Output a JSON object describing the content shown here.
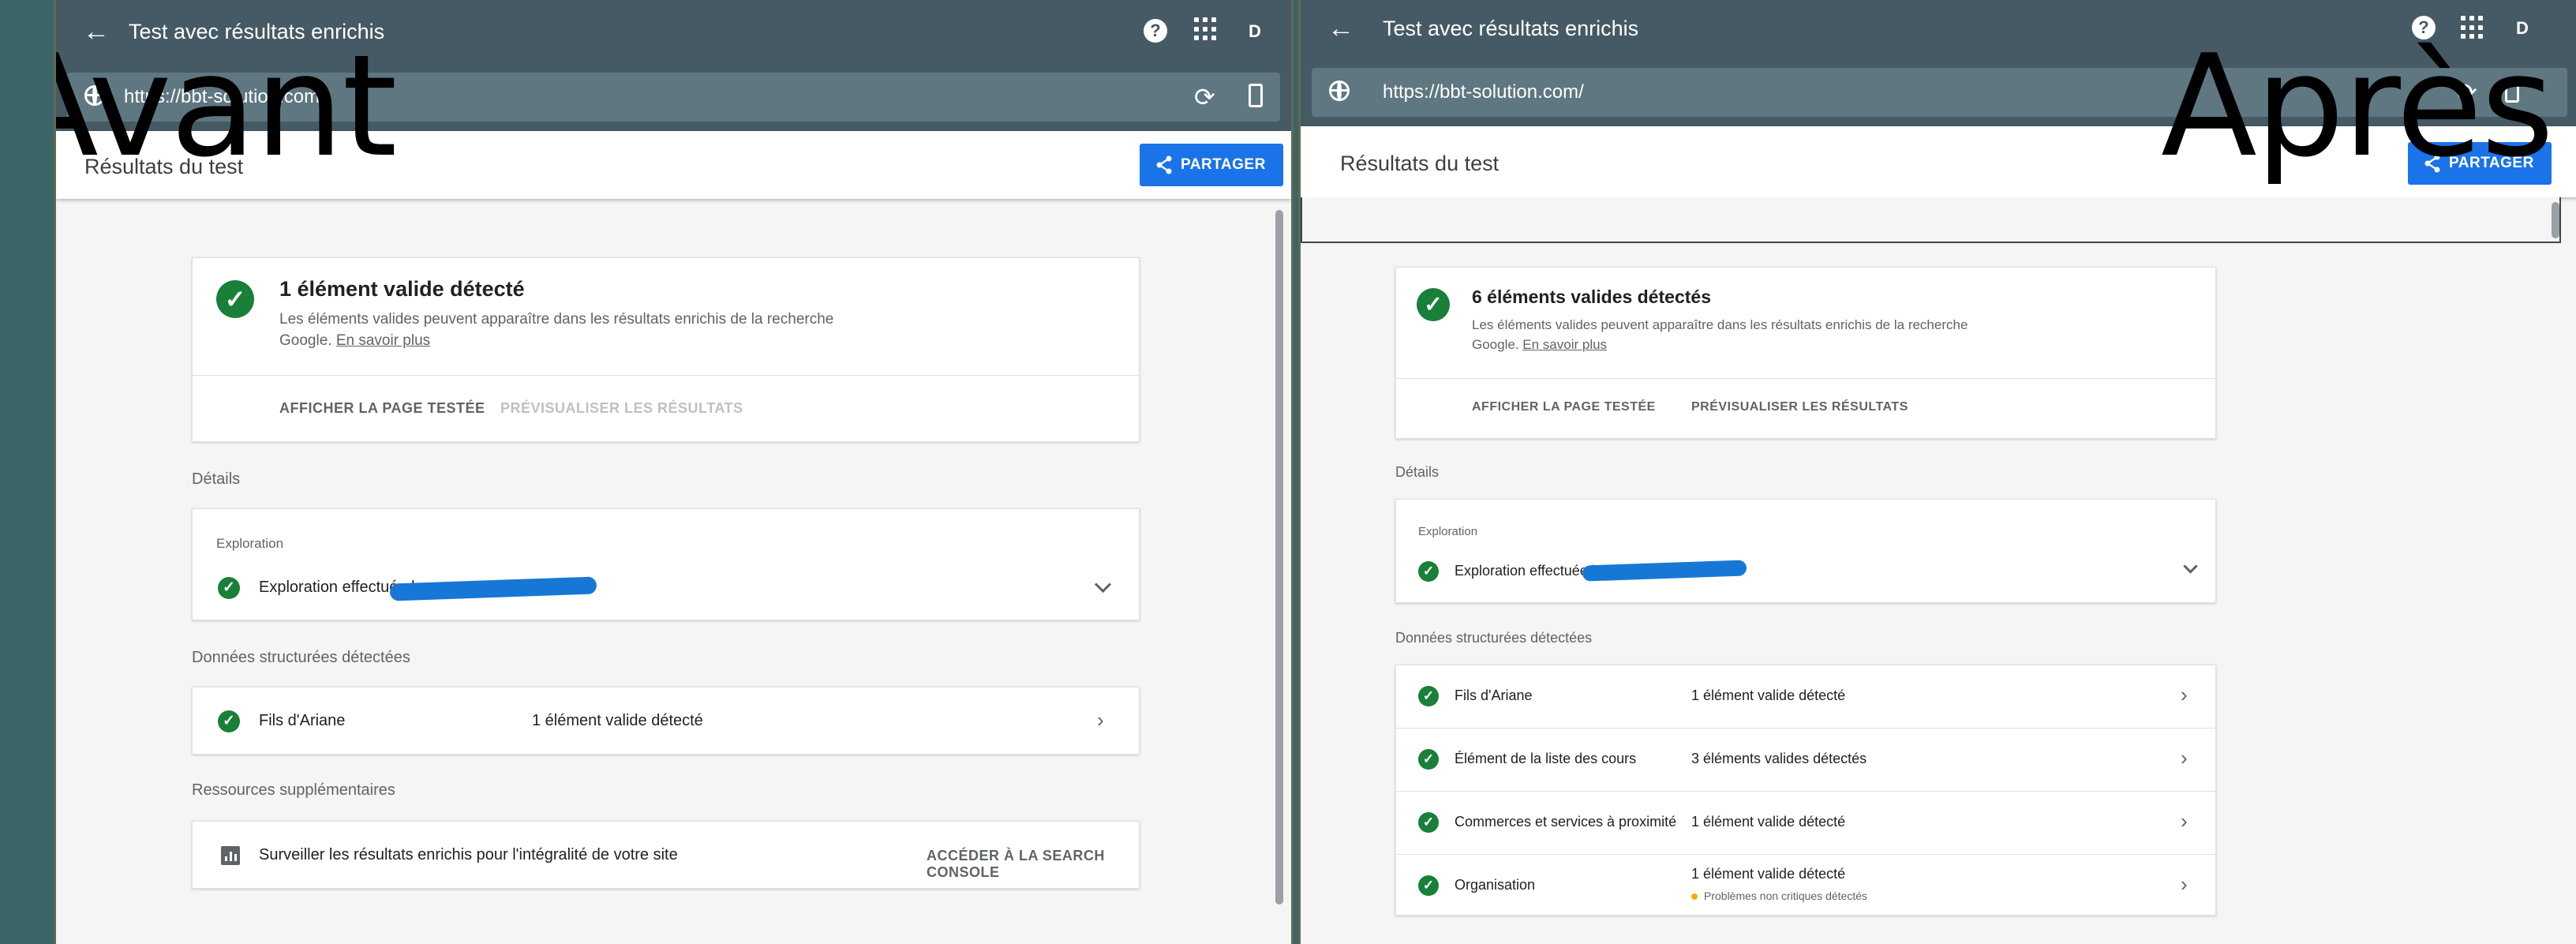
{
  "labels": {
    "before": "Avant",
    "after": "Après"
  },
  "before": {
    "window_title": "Test avec résultats enrichis",
    "avatar": "D",
    "url": "https://bbt-solution.com/",
    "header_title": "Résultats du test",
    "share_label": "PARTAGER",
    "summary": {
      "title": "1 élément valide détecté",
      "description": "Les éléments valides peuvent apparaître dans les résultats enrichis de la recherche",
      "description2": "Google.",
      "learn_more": "En savoir plus",
      "action_view": "AFFICHER LA PAGE TESTÉE",
      "action_preview": "PRÉVISUALISER LES RÉSULTATS"
    },
    "details_label": "Détails",
    "exploration": {
      "label": "Exploration",
      "text": "Exploration effectuée le"
    },
    "structured_label": "Données structurées détectées",
    "structured_items": [
      {
        "name": "Fils d'Ariane",
        "status": "1 élément valide détecté"
      }
    ],
    "resources_label": "Ressources supplémentaires",
    "resource": {
      "text": "Surveiller les résultats enrichis pour l'intégralité de votre site",
      "action": "ACCÉDER À LA SEARCH CONSOLE"
    }
  },
  "after": {
    "window_title": "Test avec résultats enrichis",
    "avatar": "D",
    "url": "https://bbt-solution.com/",
    "header_title": "Résultats du test",
    "share_label": "PARTAGER",
    "summary": {
      "title": "6 éléments valides détectés",
      "description": "Les éléments valides peuvent apparaître dans les résultats enrichis de la recherche",
      "description2": "Google.",
      "learn_more": "En savoir plus",
      "action_view": "AFFICHER LA PAGE TESTÉE",
      "action_preview": "PRÉVISUALISER LES RÉSULTATS"
    },
    "details_label": "Détails",
    "exploration": {
      "label": "Exploration",
      "text": "Exploration effectuée le"
    },
    "structured_label": "Données structurées détectées",
    "structured_items": [
      {
        "name": "Fils d'Ariane",
        "status": "1 élément valide détecté"
      },
      {
        "name": "Élément de la liste des cours",
        "status": "3 éléments valides détectés"
      },
      {
        "name": "Commerces et services à proximité",
        "status": "1 élément valide détecté"
      },
      {
        "name": "Organisation",
        "status": "1 élément valide détecté",
        "note": "Problèmes non critiques détectés"
      }
    ]
  },
  "colors": {
    "topbar": "#455a64",
    "accent": "#1a73e8",
    "valid": "#188038",
    "warning": "#f9ab00"
  },
  "icons": [
    "back-arrow-icon",
    "help-icon",
    "apps-grid-icon",
    "globe-icon",
    "reload-icon",
    "device-icon",
    "share-icon",
    "check-circle-icon",
    "chevron-down-icon",
    "chevron-right-icon",
    "bar-chart-icon"
  ]
}
